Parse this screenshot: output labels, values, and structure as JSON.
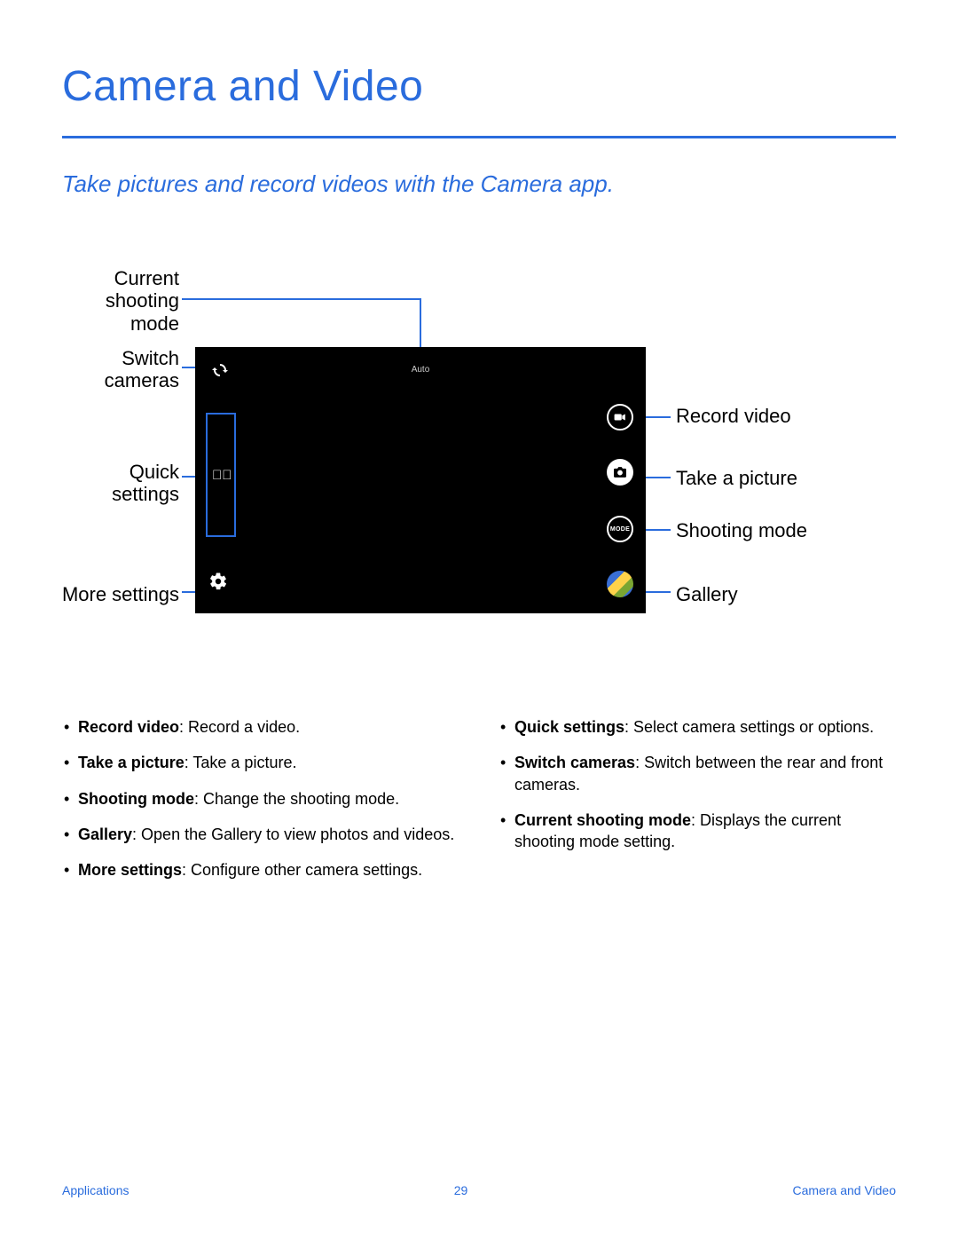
{
  "title": "Camera and Video",
  "subtitle": "Take pictures and record videos with the Camera app.",
  "screen": {
    "mode_label": "Auto",
    "mode_btn": "MODE"
  },
  "callouts": {
    "current_mode": "Current shooting mode",
    "switch_cameras": "Switch cameras",
    "quick_settings": "Quick settings",
    "more_settings": "More settings",
    "record_video": "Record video",
    "take_picture": "Take a picture",
    "shooting_mode": "Shooting mode",
    "gallery": "Gallery"
  },
  "bullets": {
    "left": [
      {
        "term": "Record video",
        "desc": ": Record a video."
      },
      {
        "term": "Take a picture",
        "desc": ": Take a picture."
      },
      {
        "term": "Shooting mode",
        "desc": ": Change the shooting mode."
      },
      {
        "term": "Gallery",
        "desc": ": Open the Gallery to view photos and videos."
      },
      {
        "term": "More settings",
        "desc": ": Configure other camera settings."
      }
    ],
    "right": [
      {
        "term": "Quick settings",
        "desc": ": Select camera settings or options."
      },
      {
        "term": "Switch cameras",
        "desc": ": Switch between the rear and front cameras."
      },
      {
        "term": "Current shooting mode",
        "desc": ": Displays the current shooting mode setting."
      }
    ]
  },
  "footer": {
    "left": "Applications",
    "center": "29",
    "right": "Camera and Video"
  }
}
